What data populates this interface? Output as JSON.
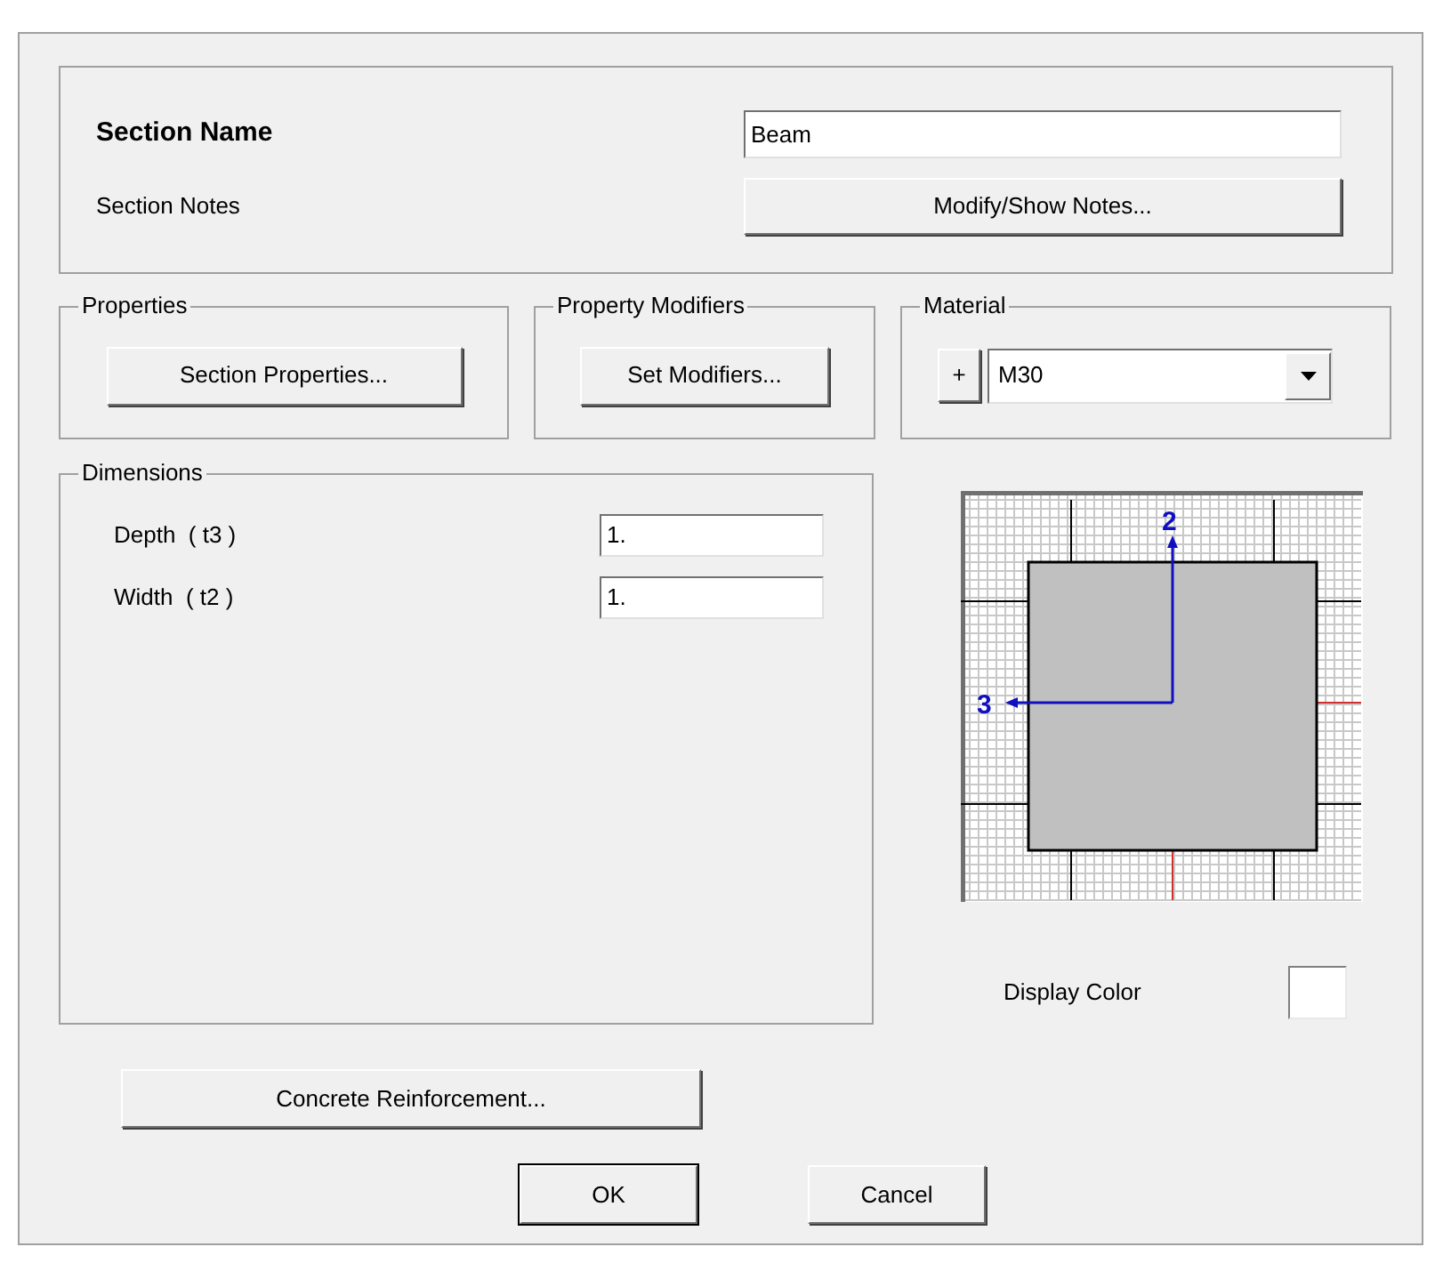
{
  "section_name": {
    "label": "Section Name",
    "value": "Beam"
  },
  "section_notes": {
    "label": "Section Notes",
    "button": "Modify/Show Notes..."
  },
  "properties": {
    "title": "Properties",
    "button": "Section Properties..."
  },
  "property_modifiers": {
    "title": "Property Modifiers",
    "button": "Set Modifiers..."
  },
  "material": {
    "title": "Material",
    "add_button": "+",
    "value": "M30"
  },
  "dimensions": {
    "title": "Dimensions",
    "fields": [
      {
        "label": "Depth  ( t3 )",
        "value": "1."
      },
      {
        "label": "Width  ( t2 )",
        "value": "1."
      }
    ]
  },
  "preview": {
    "axis_labels": [
      "2",
      "3"
    ]
  },
  "display_color": {
    "label": "Display Color"
  },
  "buttons": [
    {
      "kind": "wide",
      "label": "Concrete Reinforcement..."
    },
    {
      "kind": "default",
      "label": "OK"
    },
    {
      "kind": "normal",
      "label": "Cancel"
    }
  ]
}
